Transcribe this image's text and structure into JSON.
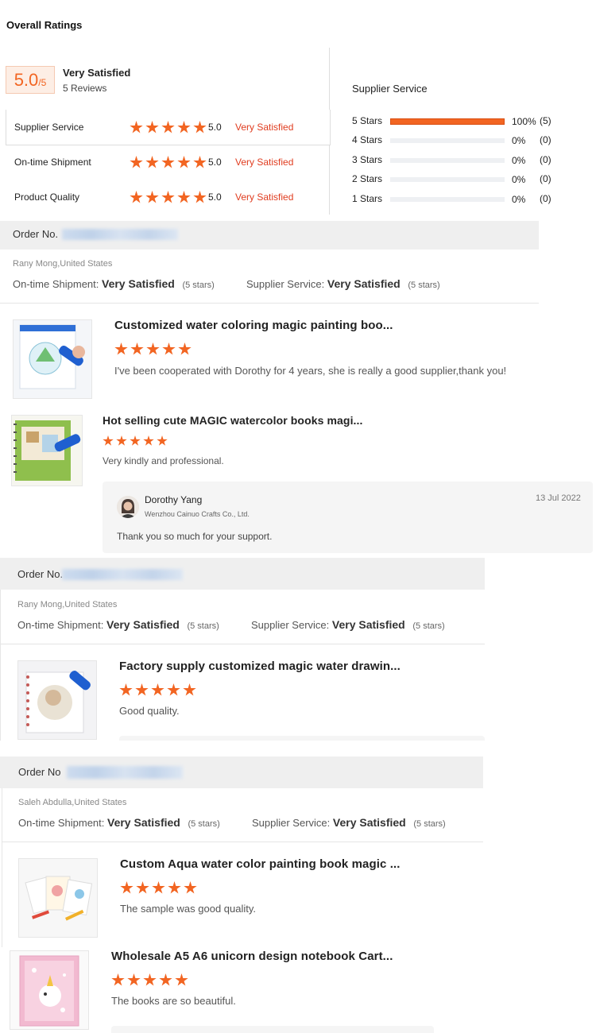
{
  "overall": {
    "heading": "Overall Ratings",
    "score": "5.0",
    "score_suffix": "/5",
    "label": "Very Satisfied",
    "reviews": "5 Reviews"
  },
  "categories": [
    {
      "name": "Supplier Service",
      "score": "5.0",
      "label": "Very Satisfied",
      "stars": 5
    },
    {
      "name": "On-time Shipment",
      "score": "5.0",
      "label": "Very Satisfied",
      "stars": 5
    },
    {
      "name": "Product Quality",
      "score": "5.0",
      "label": "Very Satisfied",
      "stars": 5
    }
  ],
  "breakdown": {
    "title": "Supplier Service",
    "rows": [
      {
        "label": "5 Stars",
        "pct": "100%",
        "count": "(5)",
        "fraction": 1.0
      },
      {
        "label": "4 Stars",
        "pct": "0%",
        "count": "(0)",
        "fraction": 0
      },
      {
        "label": "3 Stars",
        "pct": "0%",
        "count": "(0)",
        "fraction": 0
      },
      {
        "label": "2 Stars",
        "pct": "0%",
        "count": "(0)",
        "fraction": 0
      },
      {
        "label": "1 Stars",
        "pct": "0%",
        "count": "(0)",
        "fraction": 0
      }
    ]
  },
  "orders": [
    {
      "order_label": "Order No.",
      "order_prefix_visible": "Order No.",
      "buyer": "Rany Mong,United States",
      "shipment_label": "On-time Shipment:",
      "shipment_value": "Very Satisfied",
      "shipment_stars": "(5 stars)",
      "service_label": "Supplier Service:",
      "service_value": "Very Satisfied",
      "service_stars": "(5 stars)",
      "items": [
        {
          "title": "Customized water coloring magic painting boo...",
          "review": "I've been cooperated with Dorothy for 4 years, she is really a good supplier,thank you!",
          "stars": 5
        },
        {
          "title": "Hot selling cute MAGIC watercolor books magi...",
          "review": "Very kindly and professional.",
          "stars": 5
        }
      ],
      "reply": {
        "name": "Dorothy Yang",
        "company": "Wenzhou Cainuo Crafts Co., Ltd.",
        "date": "13 Jul 2022",
        "text": "Thank you so much for your support."
      }
    },
    {
      "order_label": "Order No.",
      "buyer": "Rany Mong,United States",
      "shipment_label": "On-time Shipment:",
      "shipment_value": "Very Satisfied",
      "shipment_stars": "(5 stars)",
      "service_label": "Supplier Service:",
      "service_value": "Very Satisfied",
      "service_stars": "(5 stars)",
      "items": [
        {
          "title": "Factory supply customized magic water drawin...",
          "review": "Good quality.",
          "stars": 5
        }
      ]
    },
    {
      "order_label": "Order No",
      "buyer": "Saleh Abdulla,United States",
      "shipment_label": "On-time Shipment:",
      "shipment_value": "Very Satisfied",
      "shipment_stars": "(5 stars)",
      "service_label": "Supplier Service:",
      "service_value": "Very Satisfied",
      "service_stars": "(5 stars)",
      "items": [
        {
          "title": "Custom Aqua water color painting book magic ...",
          "review": "The sample was good quality.",
          "stars": 5
        },
        {
          "title": "Wholesale A5 A6 unicorn design notebook Cart...",
          "review": "The books are so beautiful.",
          "stars": 5
        }
      ]
    }
  ],
  "colors": {
    "accent": "#f26522",
    "satisfied": "#e03c1f",
    "order_bar": "#efefef"
  }
}
